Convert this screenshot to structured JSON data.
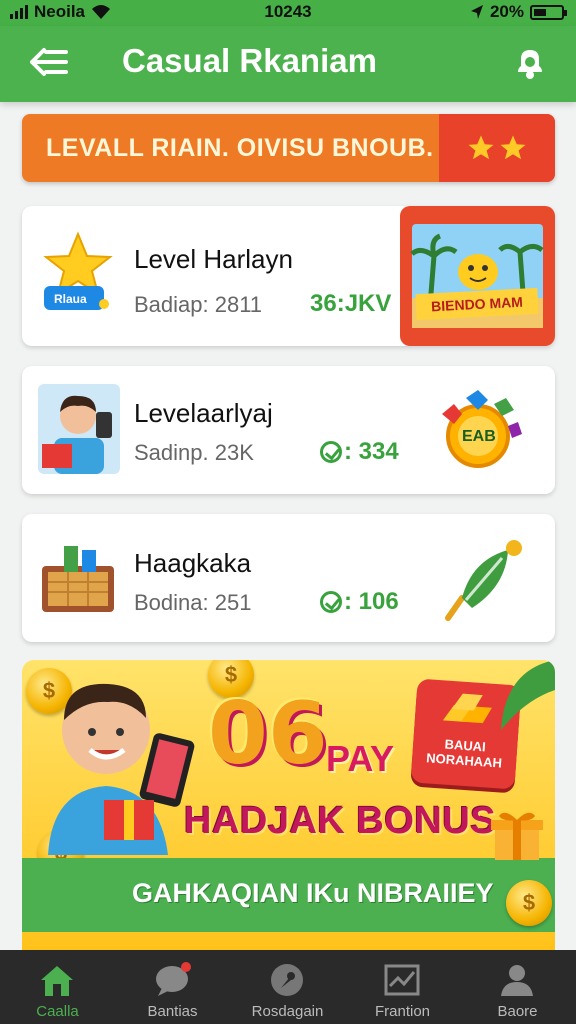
{
  "status_bar": {
    "carrier": "Neoila",
    "time": "10243",
    "battery": "20%"
  },
  "header": {
    "title": "Casual Rkaniam"
  },
  "level_banner": {
    "text": "LEVALL RIAIN.  OIVISU  BNOUB."
  },
  "cards": [
    {
      "title": "Level Harlayn",
      "subtitle": "Badiap: 2811",
      "value": "36:JKV",
      "icon": "star-trophy-icon",
      "icon_label": "Rlaua",
      "promo_label": "BIENDO MAM"
    },
    {
      "title": "Levelaarlyaj",
      "subtitle": "Sadinp. 23K",
      "value": ": 334",
      "icon": "boy-avatar-icon",
      "badge_label": "EAB"
    },
    {
      "title": "Haagkaka",
      "subtitle": "Bodina: 251",
      "value": ": 106",
      "icon": "gift-box-icon"
    }
  ],
  "hero": {
    "big_text": "06",
    "pay_text": "PAY",
    "badge_text": "BAUAI NORAHAAH",
    "bonus_text": "HADJAK BONUS",
    "strip_text": "GAHKAQIAN IKu NIBRAIIEY",
    "coin_symbol": "$"
  },
  "bottom_nav": [
    {
      "label": "Caalla",
      "icon": "home-icon",
      "active": true
    },
    {
      "label": "Bantias",
      "icon": "chat-icon",
      "active": false
    },
    {
      "label": "Rosdagain",
      "icon": "compass-icon",
      "active": false
    },
    {
      "label": "Frantion",
      "icon": "chart-icon",
      "active": false
    },
    {
      "label": "Baore",
      "icon": "profile-icon",
      "active": false
    }
  ],
  "colors": {
    "primary_green": "#4cb24d",
    "accent_orange": "#ee7a25",
    "accent_red": "#e8432a",
    "value_green": "#38a33c"
  }
}
